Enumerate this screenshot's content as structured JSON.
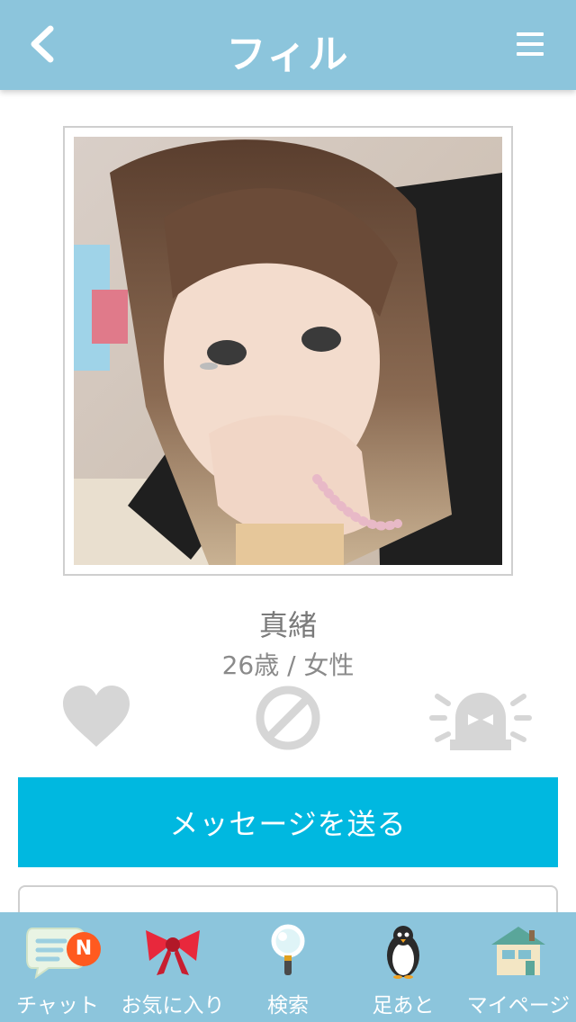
{
  "header": {
    "title": "フィル",
    "back_icon": "chevron-left-icon",
    "menu_icon": "hamburger-menu-icon"
  },
  "profile": {
    "name": "真緒",
    "meta": "26歳 / 女性"
  },
  "actions": [
    {
      "name": "like",
      "icon": "heart-icon"
    },
    {
      "name": "block",
      "icon": "block-icon"
    },
    {
      "name": "report",
      "icon": "alarm-light-icon"
    }
  ],
  "message_button": {
    "label": "メッセージを送る"
  },
  "tabbar": {
    "items": [
      {
        "label": "チャット",
        "icon": "chat-bubble-icon",
        "badge": "N"
      },
      {
        "label": "お気に入り",
        "icon": "ribbon-icon"
      },
      {
        "label": "検索",
        "icon": "magnifier-icon"
      },
      {
        "label": "足あと",
        "icon": "penguin-icon"
      },
      {
        "label": "マイページ",
        "icon": "house-icon"
      }
    ]
  },
  "colors": {
    "header_bg": "#8cc5dc",
    "button_bg": "#00b8e0",
    "badge_bg": "#ff5a1f",
    "icon_gray": "#d6d6d6"
  }
}
